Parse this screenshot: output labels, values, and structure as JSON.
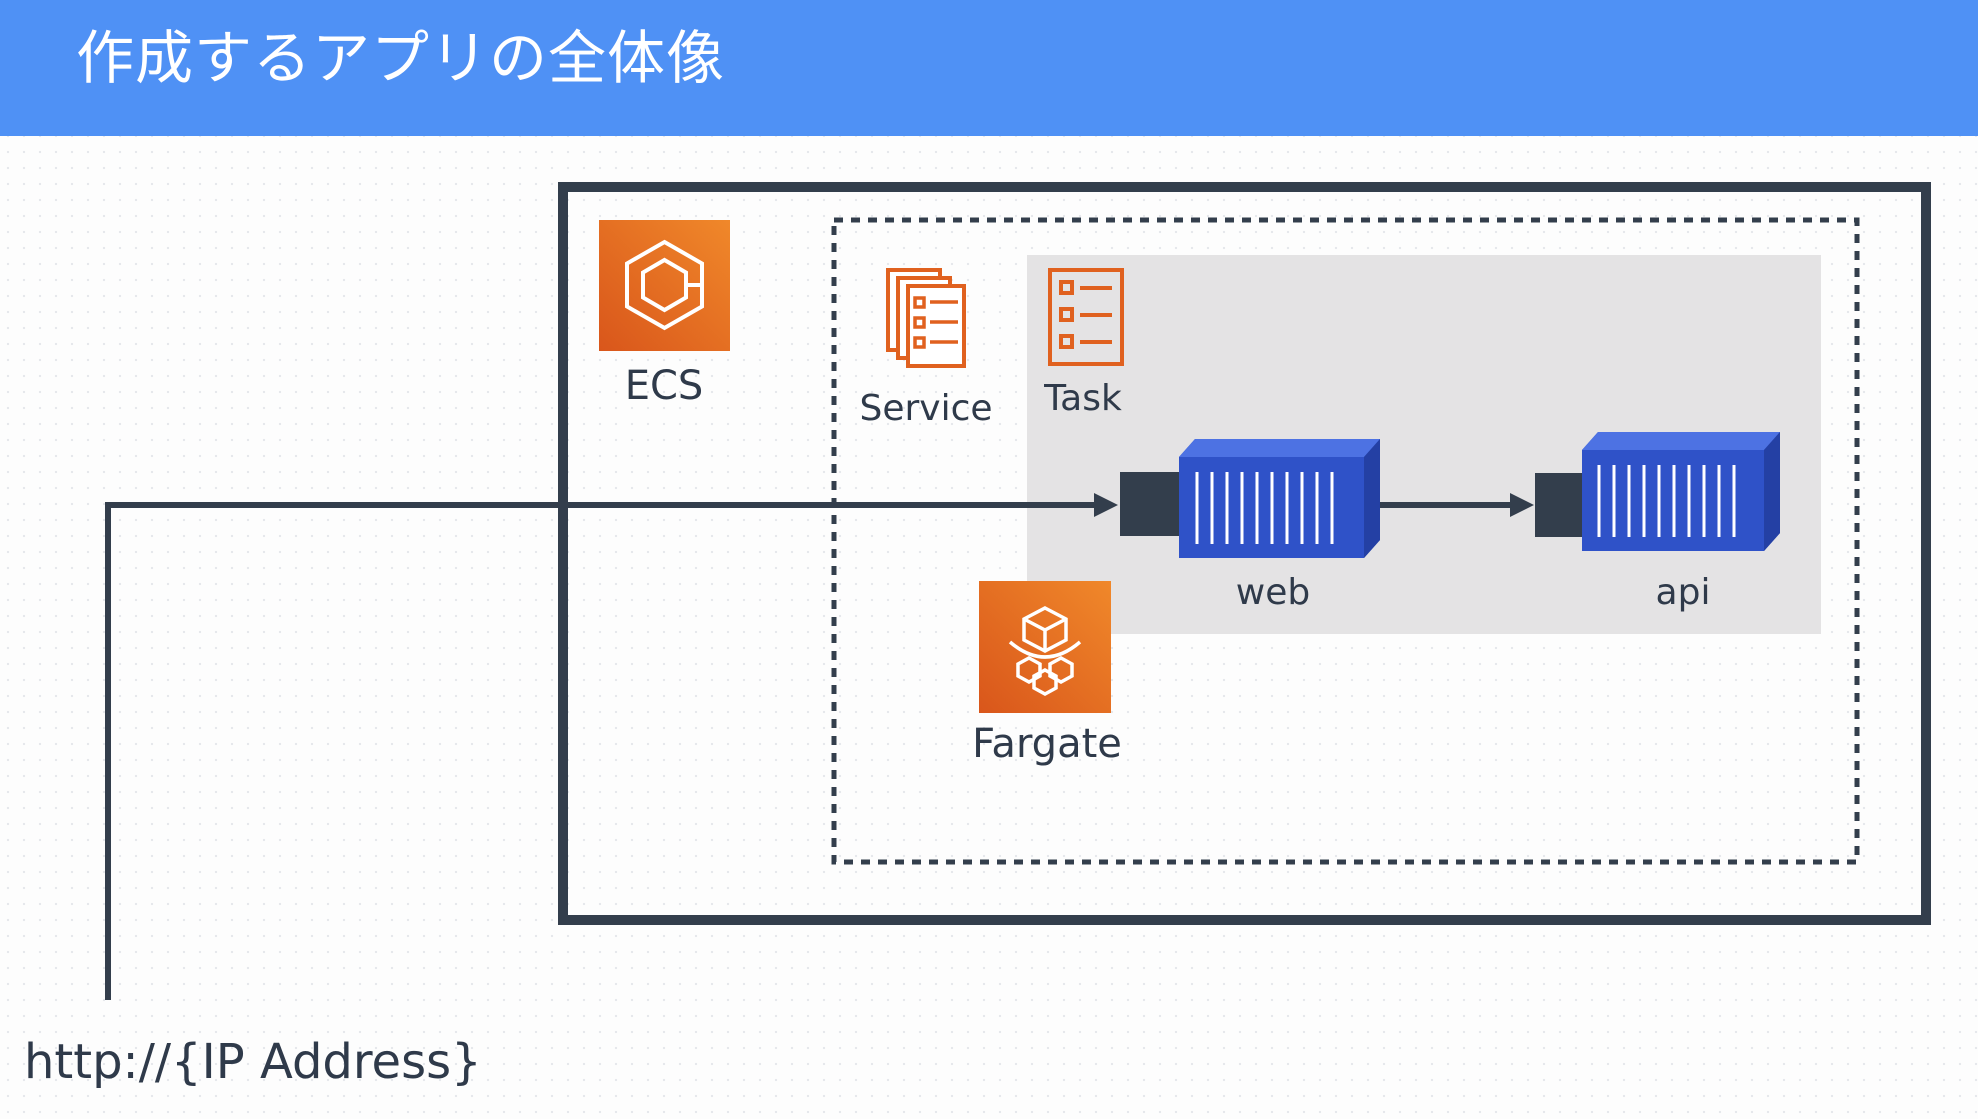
{
  "header": {
    "title": "作成するアプリの全体像"
  },
  "diagram": {
    "ecs_label": "ECS",
    "service_label": "Service",
    "task_label": "Task",
    "fargate_label": "Fargate",
    "containers": [
      {
        "label": "web"
      },
      {
        "label": "api"
      }
    ],
    "endpoint_label": "http://{IP Address}"
  },
  "colors": {
    "header_bg": "#4f91f5",
    "border": "#333e4c",
    "aws_orange_light": "#f0882a",
    "aws_orange_dark": "#d9561b",
    "container_blue": "#2f52c8",
    "task_bg": "#e4e3e4",
    "text": "#2f3a4a"
  },
  "icons": [
    "ecs-icon",
    "service-icon",
    "task-icon",
    "fargate-icon",
    "container-icon"
  ]
}
